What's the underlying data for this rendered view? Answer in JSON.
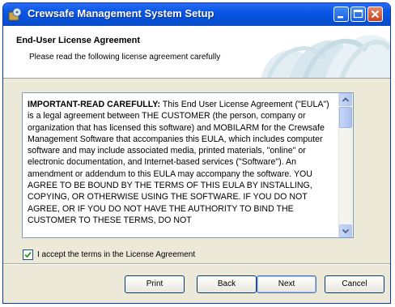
{
  "window": {
    "title": "Crewsafe Management System Setup"
  },
  "banner": {
    "title": "End-User License Agreement",
    "subtitle": "Please read the following license agreement carefully"
  },
  "eula": {
    "heading": "IMPORTANT-READ CAREFULLY:",
    "body": " This End User License Agreement (\"EULA\") is a legal agreement between THE CUSTOMER (the person, company or organization that has licensed this software) and MOBILARM for the Crewsafe Management Software that accompanies this EULA, which includes computer software and may include associated media, printed materials, \"online\" or electronic documentation, and Internet-based services (\"Software\"). An amendment or addendum to this EULA may accompany the software. YOU AGREE TO BE BOUND BY THE TERMS OF THIS EULA BY INSTALLING, COPYING, OR OTHERWISE USING THE SOFTWARE. IF YOU DO NOT AGREE, OR IF YOU DO NOT HAVE THE AUTHORITY TO BIND THE CUSTOMER TO THESE TERMS, DO NOT"
  },
  "accept": {
    "label": "I accept the terms in the License Agreement",
    "checked": true
  },
  "buttons": {
    "print": "Print",
    "back": "Back",
    "next": "Next",
    "cancel": "Cancel"
  },
  "icons": {
    "app": "setup-disk-icon",
    "minimize": "minimize-icon",
    "maximize": "maximize-icon",
    "close": "close-icon",
    "scroll_up": "scroll-up-arrow-icon",
    "scroll_down": "scroll-down-arrow-icon",
    "checkmark": "checkmark-icon"
  },
  "colors": {
    "titlebar": "#0a58e8",
    "close_button": "#c8431d",
    "dialog_background": "#ece9d8"
  }
}
